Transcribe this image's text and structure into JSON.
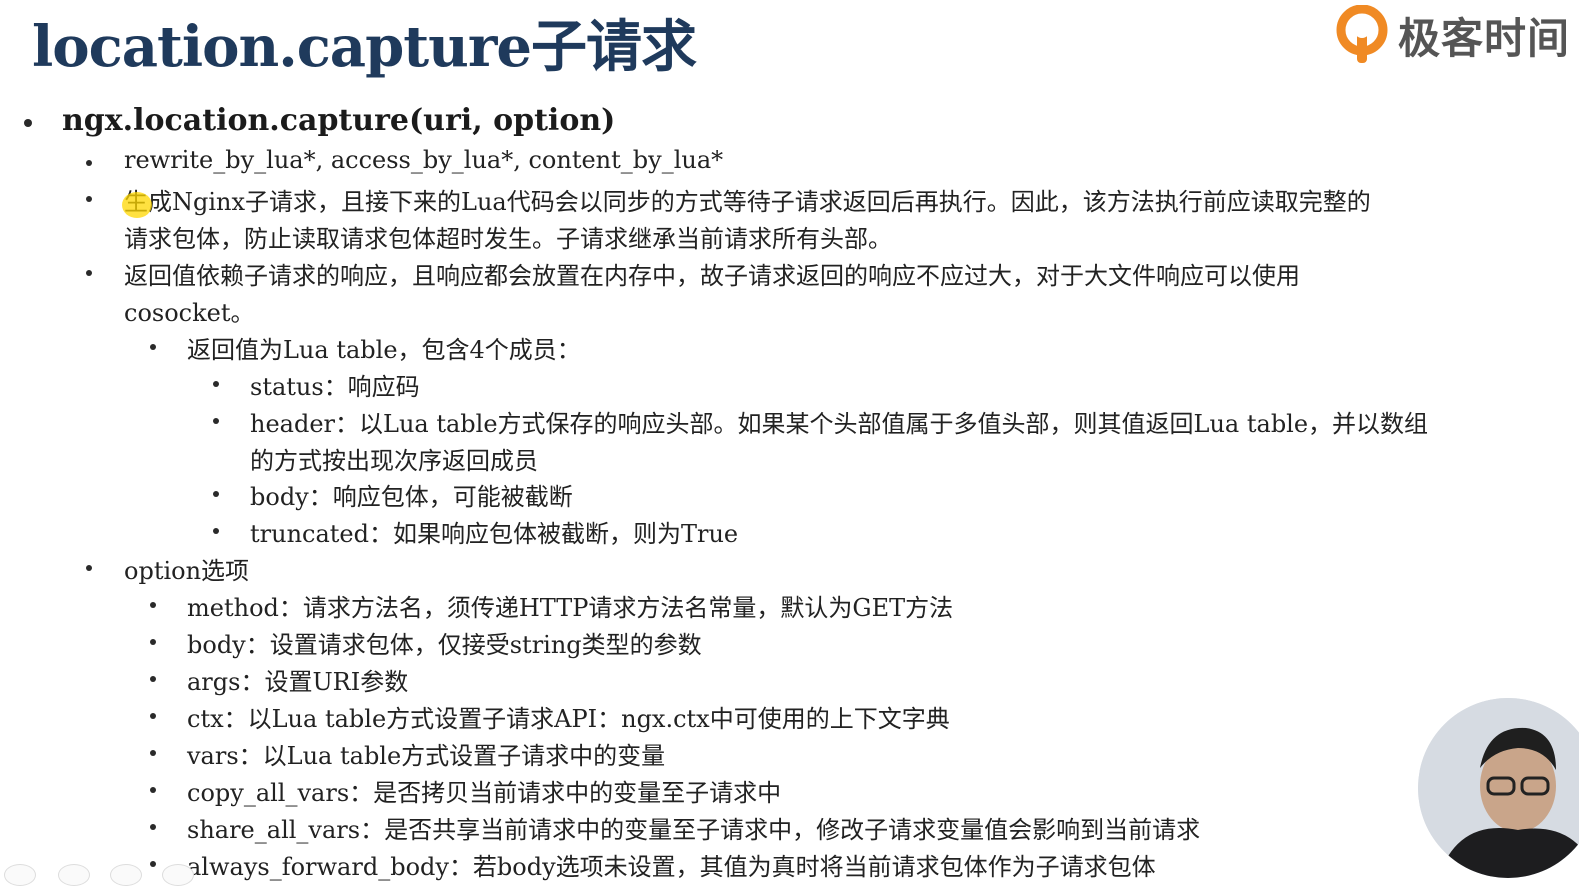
{
  "slide": {
    "title": "location.capture子请求",
    "brand": "极客时间"
  },
  "items": [
    {
      "level": 1,
      "text": "ngx.location.capture(uri, option)"
    },
    {
      "level": 2,
      "text": "rewrite_by_lua*, access_by_lua*, content_by_lua*"
    },
    {
      "level": 2,
      "text": "生成Nginx子请求，且接下来的Lua代码会以同步的方式等待子请求返回后再执行。因此，该方法执行前应读取完整的",
      "cont": "请求包体，防止读取请求包体超时发生。子请求继承当前请求所有头部。"
    },
    {
      "level": 2,
      "text": "返回值依赖子请求的响应，且响应都会放置在内存中，故子请求返回的响应不应过大，对于大文件响应可以使用",
      "cont": "cosocket。"
    },
    {
      "level": 3,
      "text": "返回值为Lua table，包含4个成员："
    },
    {
      "level": 4,
      "text": "status：响应码"
    },
    {
      "level": 4,
      "text": "header：以Lua table方式保存的响应头部。如果某个头部值属于多值头部，则其值返回Lua table，并以数组",
      "cont": "的方式按出现次序返回成员"
    },
    {
      "level": 4,
      "text": "body：响应包体，可能被截断"
    },
    {
      "level": 4,
      "text": "truncated：如果响应包体被截断，则为True"
    },
    {
      "level": 2,
      "text": "option选项"
    },
    {
      "level": 3,
      "text": "method：请求方法名，须传递HTTP请求方法名常量，默认为GET方法"
    },
    {
      "level": 3,
      "text": "body：设置请求包体，仅接受string类型的参数"
    },
    {
      "level": 3,
      "text": "args：设置URI参数"
    },
    {
      "level": 3,
      "text": "ctx：以Lua table方式设置子请求API：ngx.ctx中可使用的上下文字典"
    },
    {
      "level": 3,
      "text": "vars：以Lua table方式设置子请求中的变量"
    },
    {
      "level": 3,
      "text": "copy_all_vars：是否拷贝当前请求中的变量至子请求中"
    },
    {
      "level": 3,
      "text": "share_all_vars：是否共享当前请求中的变量至子请求中，修改子请求变量值会影响到当前请求"
    },
    {
      "level": 3,
      "text": "always_forward_body：若body选项未设置，其值为真时将当前请求包体作为子请求包体"
    }
  ],
  "colors": {
    "title": "#1f3a5c",
    "brand_orange": "#f08a24",
    "brand_text": "#555555",
    "highlight": "#ffd700"
  },
  "icons": {
    "brand_logo": "geektime-logo-icon",
    "bullet": "bullet-dot-icon",
    "cursor": "mouse-cursor-icon"
  }
}
